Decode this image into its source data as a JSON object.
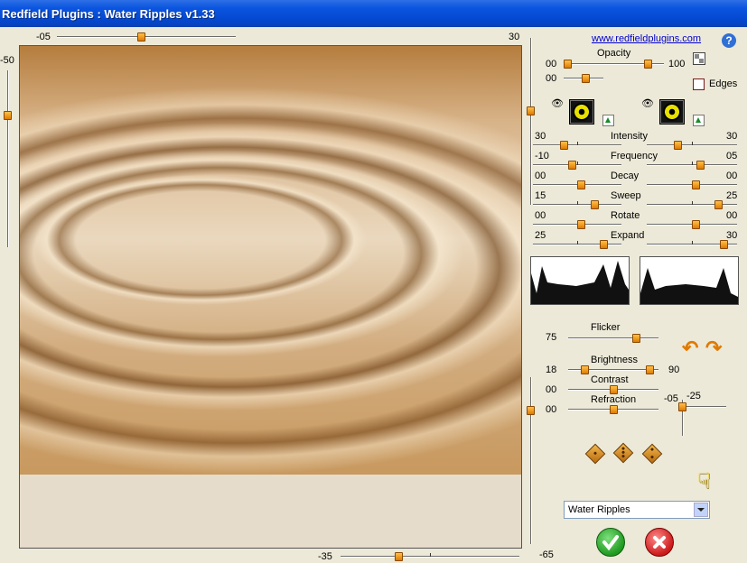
{
  "window": {
    "title": "Redfield Plugins : Water Ripples v1.33"
  },
  "link": {
    "text": "www.redfieldplugins.com"
  },
  "help_icon": "question-mark-icon",
  "top_slider": {
    "min_label": "-05",
    "max_label": "30"
  },
  "left_slider": {
    "label": "-50"
  },
  "bottom_slider": {
    "label": "-35"
  },
  "right_slider": {
    "label": "-65"
  },
  "opacity": {
    "label": "Opacity",
    "left_value": "00",
    "right_value": "100",
    "second_value": "00"
  },
  "edges": {
    "label": "Edges",
    "checked": false
  },
  "params": [
    {
      "name": "Intensity",
      "left": "30",
      "right": "30"
    },
    {
      "name": "Frequency",
      "left": "-10",
      "right": "05"
    },
    {
      "name": "Decay",
      "left": "00",
      "right": "00"
    },
    {
      "name": "Sweep",
      "left": "15",
      "right": "25"
    },
    {
      "name": "Rotate",
      "left": "00",
      "right": "00"
    },
    {
      "name": "Expand",
      "left": "25",
      "right": "30"
    }
  ],
  "flicker": {
    "label": "Flicker",
    "value": "75"
  },
  "brightness": {
    "label": "Brightness",
    "left": "18",
    "right": "90"
  },
  "contrast": {
    "label": "Contrast",
    "value": "00"
  },
  "refraction": {
    "label": "Refraction",
    "value": "00"
  },
  "xy_pad": {
    "x_label": "-05",
    "y_label": "-25"
  },
  "preset": {
    "selected": "Water Ripples"
  },
  "actions": {
    "ok_icon": "checkmark-icon",
    "cancel_icon": "x-icon"
  }
}
